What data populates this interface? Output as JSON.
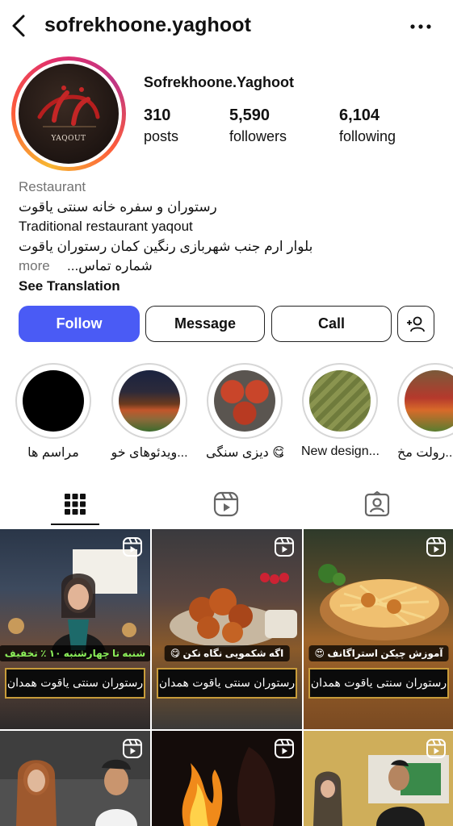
{
  "header": {
    "username": "sofrekhoone.yaghoot"
  },
  "profile": {
    "display_name": "Sofrekhoone.Yaghoot",
    "avatar_logo_text": "یاقوت",
    "avatar_sub_text": "YAQOUT",
    "stats": {
      "posts": {
        "value": "310",
        "label": "posts"
      },
      "followers": {
        "value": "5,590",
        "label": "followers"
      },
      "following": {
        "value": "6,104",
        "label": "following"
      }
    },
    "bio": {
      "category": "Restaurant",
      "line1": "رستوران و سفره خانه سنتی یاقوت",
      "line2": "Traditional restaurant yaqout",
      "line3": "بلوار ارم جنب شهربازی رنگین کمان رستوران یاقوت",
      "line4": "شماره تماس...",
      "more_label": "more",
      "see_translation": "See Translation"
    }
  },
  "actions": {
    "follow": "Follow",
    "message": "Message",
    "call": "Call"
  },
  "highlights": [
    {
      "label": "مراسم ها"
    },
    {
      "label": "ویدئوهای خو..."
    },
    {
      "label": "دیزی سنگی 😋"
    },
    {
      "label": "New design..."
    },
    {
      "label": "رولت مخ..."
    }
  ],
  "tabs": [
    {
      "name": "posts-grid",
      "icon": "grid-icon"
    },
    {
      "name": "reels",
      "icon": "reels-icon"
    },
    {
      "name": "tagged",
      "icon": "tagged-person-icon"
    }
  ],
  "posts": [
    {
      "caption": "شنبه تا چهارشنبه ۱۰ ٪ تخفیف",
      "brand": "رستوران سنتی یاقوت همدان"
    },
    {
      "caption": "اگه شکمویی نگاه نکن 😋",
      "brand": "رستوران سنتی یاقوت همدان"
    },
    {
      "caption": "آموزش چیکن استراگانف 😍",
      "brand": "رستوران سنتی یاقوت همدان"
    }
  ],
  "colors": {
    "accent": "#4a5bf5",
    "brand_gold": "#c89c3a",
    "caption_green": "#8cf05a"
  }
}
